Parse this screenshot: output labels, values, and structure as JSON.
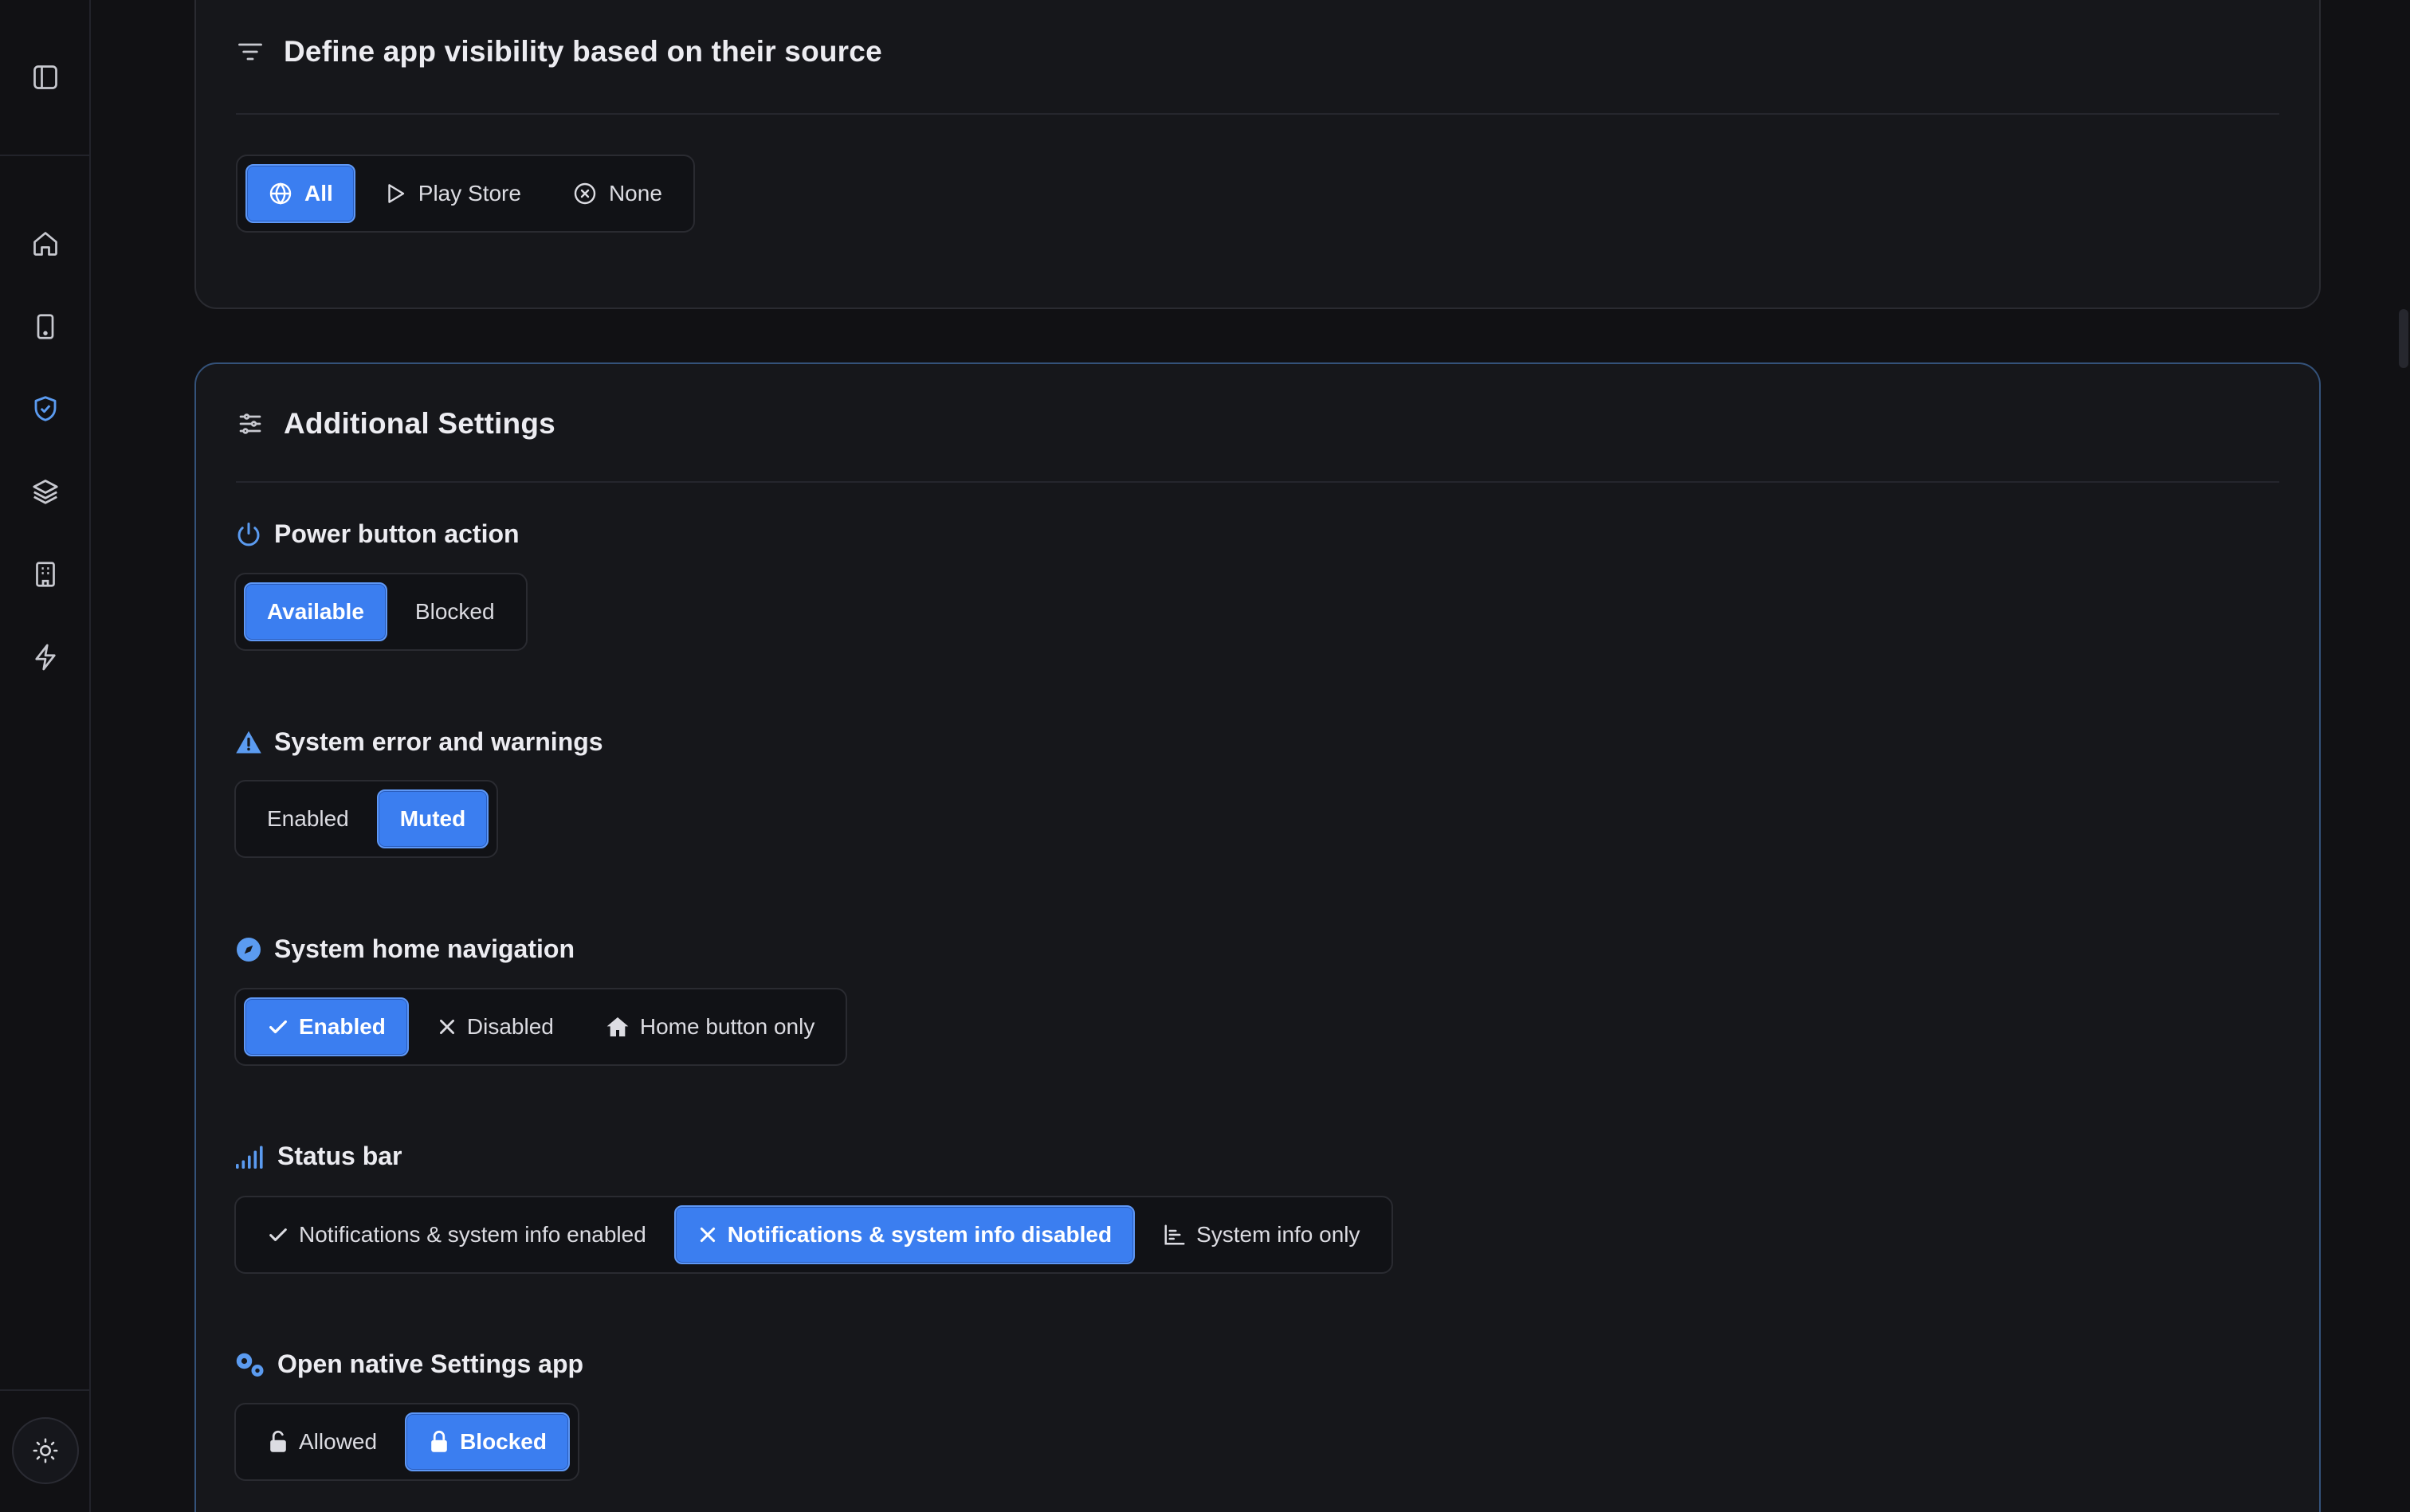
{
  "colors": {
    "accent": "#3b7ef0",
    "icon_blue": "#5b9bf0",
    "icon_grey": "#c8c9d0"
  },
  "sidebar": {
    "toggle_icon": "sidebar-panel-icon",
    "items": [
      {
        "icon": "home-icon"
      },
      {
        "icon": "device-icon"
      },
      {
        "icon": "shield-check-icon",
        "active": true
      },
      {
        "icon": "layers-icon"
      },
      {
        "icon": "building-icon"
      },
      {
        "icon": "lightning-icon"
      }
    ],
    "theme_icon": "sun-icon"
  },
  "visibility_card": {
    "title": "Define app visibility based on their source",
    "options": [
      {
        "label": "All",
        "icon": "globe-icon",
        "selected": true
      },
      {
        "label": "Play Store",
        "icon": "play-icon",
        "selected": false
      },
      {
        "label": "None",
        "icon": "x-circle-icon",
        "selected": false
      }
    ]
  },
  "additional_card": {
    "title": "Additional Settings",
    "power": {
      "title": "Power button action",
      "options": [
        {
          "label": "Available",
          "selected": true
        },
        {
          "label": "Blocked",
          "selected": false
        }
      ]
    },
    "errors": {
      "title": "System error and warnings",
      "options": [
        {
          "label": "Enabled",
          "selected": false
        },
        {
          "label": "Muted",
          "selected": true
        }
      ]
    },
    "home_nav": {
      "title": "System home navigation",
      "options": [
        {
          "label": "Enabled",
          "icon": "check-icon",
          "selected": true
        },
        {
          "label": "Disabled",
          "icon": "x-icon",
          "selected": false
        },
        {
          "label": "Home button only",
          "icon": "home-icon",
          "selected": false
        }
      ]
    },
    "status_bar": {
      "title": "Status bar",
      "options": [
        {
          "label": "Notifications & system info enabled",
          "icon": "check-icon",
          "selected": false
        },
        {
          "label": "Notifications & system info disabled",
          "icon": "x-icon",
          "selected": true
        },
        {
          "label": "System info only",
          "icon": "bar-chart-icon",
          "selected": false
        }
      ]
    },
    "settings_app": {
      "title": "Open native Settings app",
      "options": [
        {
          "label": "Allowed",
          "icon": "lock-open-icon",
          "selected": false
        },
        {
          "label": "Blocked",
          "icon": "lock-icon",
          "selected": true
        }
      ]
    }
  }
}
